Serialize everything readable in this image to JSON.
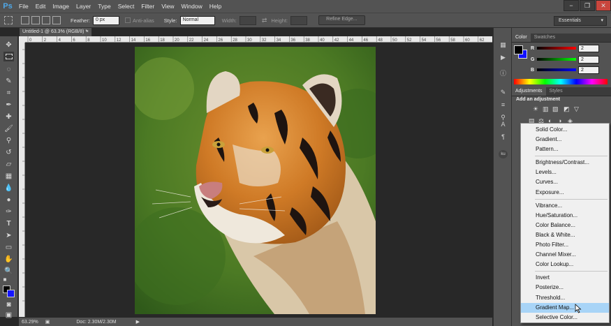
{
  "app": {
    "logo": "Ps"
  },
  "menu": [
    "File",
    "Edit",
    "Image",
    "Layer",
    "Type",
    "Select",
    "Filter",
    "View",
    "Window",
    "Help"
  ],
  "window_controls": [
    "−",
    "❐",
    "✕"
  ],
  "options_bar": {
    "feather_label": "Feather:",
    "feather_value": "0 px",
    "anti_alias_label": "Anti-alias",
    "style_label": "Style:",
    "style_value": "Normal",
    "width_label": "Width:",
    "height_label": "Height:",
    "refine_edge": "Refine Edge...",
    "workspace": "Essentials"
  },
  "document": {
    "tab": "Untitled-1 @ 63.3% (RGB/8) *"
  },
  "ruler": {
    "ticks": [
      "0",
      "2",
      "4",
      "6",
      "8",
      "10",
      "12",
      "14",
      "16",
      "18",
      "20",
      "22",
      "24",
      "26",
      "28",
      "30",
      "32",
      "34",
      "36",
      "38",
      "40",
      "42",
      "44",
      "46",
      "48",
      "50",
      "52",
      "54",
      "56",
      "58",
      "60",
      "62",
      "64"
    ]
  },
  "status": {
    "zoom": "63.29%",
    "doc": "Doc: 2.30M/2.30M"
  },
  "panels": {
    "color_tabs": [
      "Color",
      "Swatches"
    ],
    "color_sliders": [
      {
        "label": "R",
        "value": "2"
      },
      {
        "label": "G",
        "value": "2"
      },
      {
        "label": "B",
        "value": "2"
      }
    ],
    "adjust_tabs": [
      "Adjustments",
      "Styles"
    ],
    "add_adjustment": "Add an adjustment"
  },
  "dropdown": {
    "groups": [
      [
        "Solid Color...",
        "Gradient...",
        "Pattern..."
      ],
      [
        "Brightness/Contrast...",
        "Levels...",
        "Curves...",
        "Exposure..."
      ],
      [
        "Vibrance...",
        "Hue/Saturation...",
        "Color Balance...",
        "Black & White...",
        "Photo Filter...",
        "Channel Mixer...",
        "Color Lookup..."
      ],
      [
        "Invert",
        "Posterize...",
        "Threshold...",
        "Gradient Map...",
        "Selective Color..."
      ]
    ],
    "hovered": "Gradient Map..."
  }
}
